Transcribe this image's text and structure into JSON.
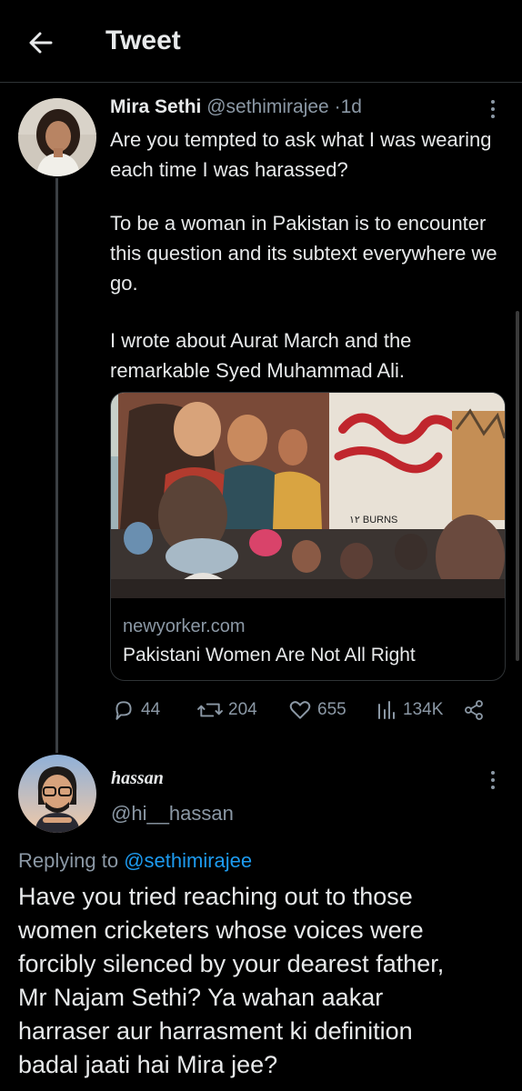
{
  "header": {
    "title": "Tweet"
  },
  "tweet": {
    "author_name": "Mira Sethi",
    "author_handle": "@sethimirajee",
    "separator": "·",
    "time": "1d",
    "paragraphs": [
      "Are you tempted to ask what I was wearing each time I was harassed?",
      "To be a woman in Pakistan is to encounter this question and its subtext everywhere we go.",
      "I wrote about Aurat March and the remarkable Syed Muhammad Ali."
    ],
    "card": {
      "domain": "newyorker.com",
      "title": "Pakistani Women Are Not All Right",
      "image_text": "۱۲ BURNS"
    },
    "actions": {
      "replies": "44",
      "retweets": "204",
      "likes": "655",
      "views": "134K"
    }
  },
  "reply": {
    "author_name": "hassan",
    "author_handle": "@hi__hassan",
    "replying_prefix": "Replying to ",
    "replying_to": "@sethimirajee",
    "lines": [
      "Have you tried reaching out to those",
      "women cricketers whose voices were",
      "forcibly silenced by your dearest father,",
      "Mr Najam Sethi? Ya wahan aakar",
      "harraser aur harrasment ki definition",
      "badal jaati hai Mira jee?"
    ]
  },
  "colors": {
    "background": "#000000",
    "text": "#e7e9ea",
    "muted": "#8b98a5",
    "link": "#1d9bf0",
    "border": "#2f3336"
  },
  "icons": [
    "back-arrow-icon",
    "more-icon",
    "reply-icon",
    "retweet-icon",
    "like-icon",
    "views-icon",
    "share-icon"
  ]
}
